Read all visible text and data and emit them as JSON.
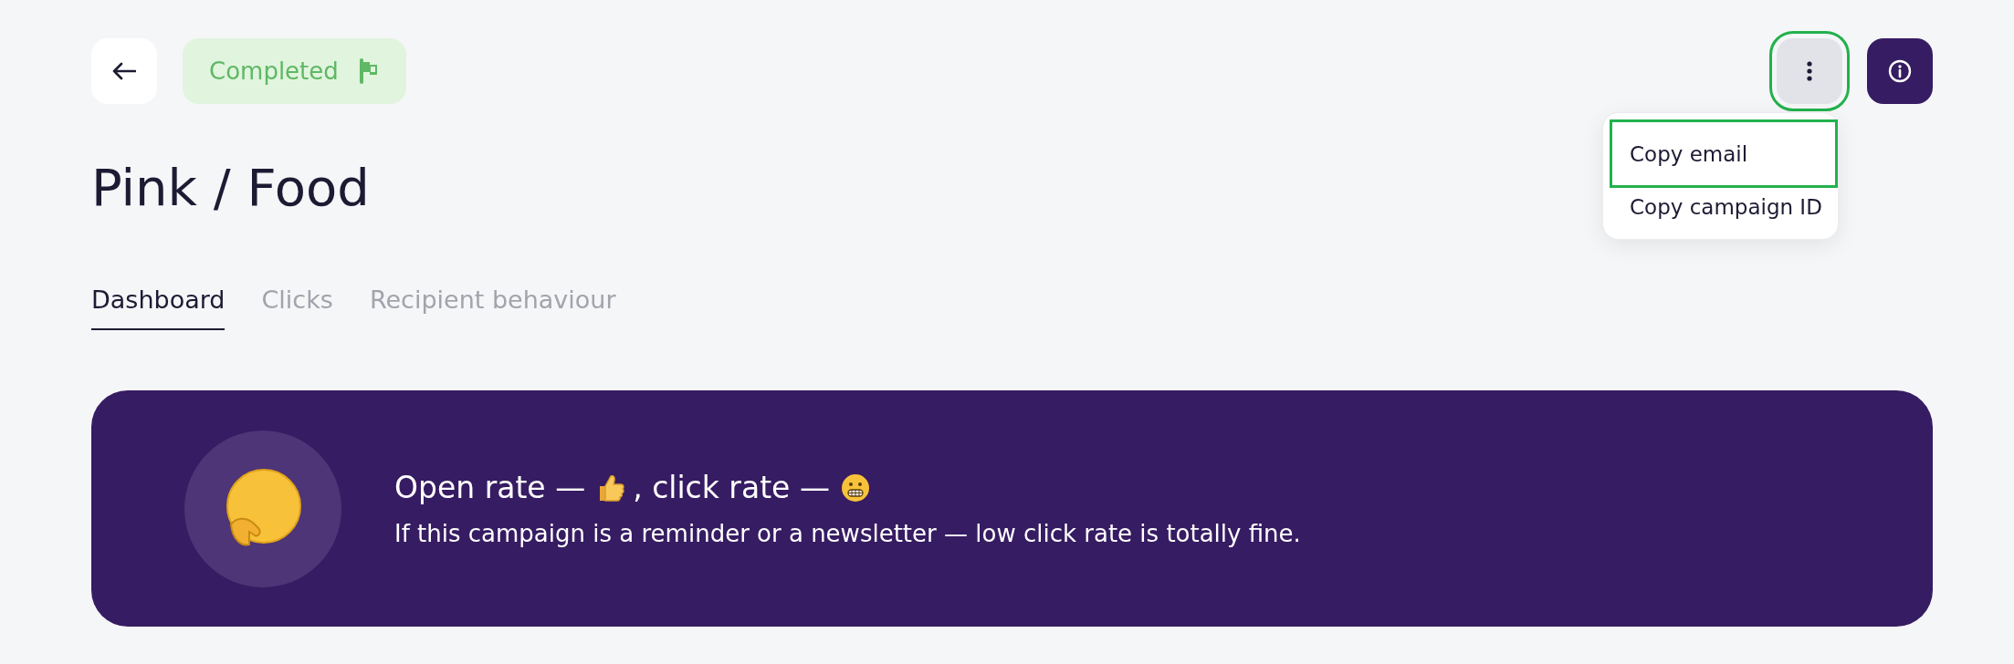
{
  "status_badge": {
    "label": "Completed"
  },
  "title": "Pink / Food",
  "more_button": {
    "highlighted": true
  },
  "menu": {
    "items": [
      {
        "label": "Copy email",
        "highlighted": true
      },
      {
        "label": "Copy campaign ID",
        "highlighted": false
      }
    ]
  },
  "tabs": [
    {
      "label": "Dashboard",
      "selected": true
    },
    {
      "label": "Clicks",
      "selected": false
    },
    {
      "label": "Recipient behaviour",
      "selected": false
    }
  ],
  "banner": {
    "heading_parts": [
      "Open rate —",
      ", click rate —"
    ],
    "text": "If this campaign is a reminder or a newsletter — low click rate is totally fine."
  }
}
